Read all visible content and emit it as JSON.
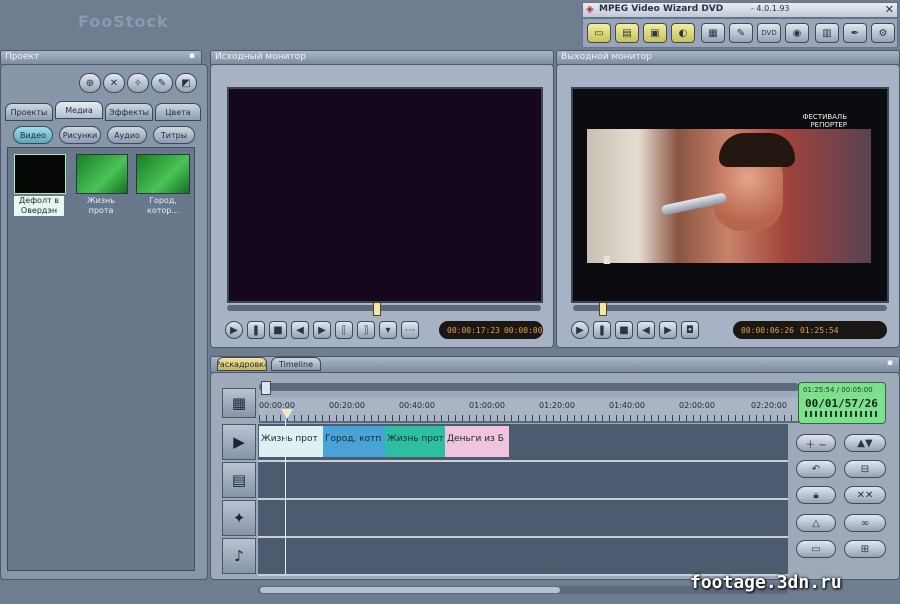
{
  "app": {
    "window_title": "MPEG Video Wizard DVD",
    "version": "- 4.0.1.93",
    "logo": "FooStock"
  },
  "window_controls": {
    "close": "✕"
  },
  "project": {
    "title": "Проект",
    "tabs": [
      "Проекты",
      "Медиа",
      "Эффекты",
      "Цвета"
    ],
    "filters": [
      "Видео",
      "Рисунки",
      "Аудио",
      "Титры"
    ],
    "media": [
      {
        "label": "Дефолт в Овердэн",
        "color": "#050805"
      },
      {
        "label": "Жизнь прота",
        "color": "#2ea83c"
      },
      {
        "label": "Город, котор...",
        "color": "#2ea83c"
      }
    ]
  },
  "source_monitor": {
    "title": "Исходный монитор",
    "timecode_a": "00:00:17:23",
    "timecode_b": "00:00:00",
    "screen_color": "#16081c"
  },
  "output_monitor": {
    "title": "Выходной монитор",
    "timecode_a": "00:00:06:26",
    "timecode_b": "01:25:54",
    "overlay_caption": "ФЕСТИВАЛЬ РЕПОРТЕР"
  },
  "timeline": {
    "tabs": [
      "Раскадровка",
      "Timeline"
    ],
    "ruler": [
      "00:00:00",
      "00:20:00",
      "00:40:00",
      "01:00:00",
      "01:20:00",
      "01:40:00",
      "02:00:00",
      "02:20:00"
    ],
    "clips": [
      {
        "label": "Жизнь прот",
        "color": "#dff0f2"
      },
      {
        "label": "Город, котп",
        "color": "#4aa3d6"
      },
      {
        "label": "Жизнь прот",
        "color": "#2dbfa2"
      },
      {
        "label": "Деньги из Б",
        "color": "#f0c4dc"
      }
    ],
    "counter_top": "01:25:54 / 00:05:00",
    "counter_main": "00/01/57/26"
  },
  "watermark": "footage.3dn.ru",
  "colors": {
    "accent": "#e0a24a",
    "frame": "#6f7d90",
    "counter_bg": "#7edf8e"
  }
}
